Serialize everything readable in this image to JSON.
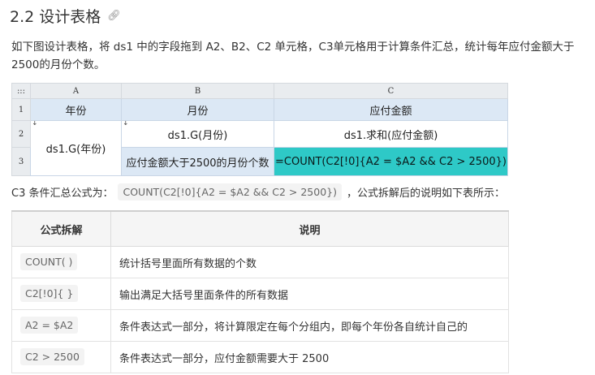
{
  "heading": {
    "title": "2.2 设计表格"
  },
  "intro": "如下图设计表格，将 ds1 中的字段拖到 A2、B2、C2 单元格，C3单元格用于计算条件汇总，统计每年应付金额大于2500的月份个数。",
  "sheet": {
    "corner": ":::",
    "columns": [
      "A",
      "B",
      "C"
    ],
    "rows": [
      "1",
      "2",
      "3"
    ],
    "header": [
      "年份",
      "月份",
      "应付金额"
    ],
    "a2": "ds1.G(年份)",
    "b2": "ds1.G(月份)",
    "c2": "ds1.求和(应付金额)",
    "b3": "应付金额大于2500的月份个数",
    "c3": "=COUNT(C2[!0]{A2 = $A2 && C2 > 2500})",
    "arrow": "↓",
    "colors": {
      "header_bg": "#dce8f5",
      "formula_bg": "#2ec9c7",
      "border": "#c9d6e6"
    }
  },
  "formula_line": {
    "prefix": "C3 条件汇总公式为：",
    "code": "COUNT(C2[!0]{A2 = $A2 && C2 > 2500})",
    "suffix": "，公式拆解后的说明如下表所示："
  },
  "explain": {
    "headers": [
      "公式拆解",
      "说明"
    ],
    "rows": [
      {
        "code": "COUNT( )",
        "desc": "统计括号里面所有数据的个数"
      },
      {
        "code": "C2[!0]{ }",
        "desc": "输出满足大括号里面条件的所有数据"
      },
      {
        "code": "A2 = $A2",
        "desc": "条件表达式一部分，将计算限定在每个分组内，即每个年份各自统计自己的"
      },
      {
        "code": "C2 > 2500",
        "desc": "条件表达式一部分，应付金额需要大于 2500"
      }
    ]
  }
}
